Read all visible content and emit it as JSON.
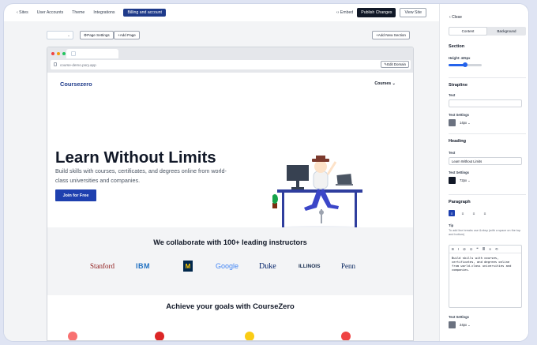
{
  "topbar": {
    "back": "Sites",
    "nav": [
      "User Accounts",
      "Theme",
      "Integrations",
      "Billing and account"
    ],
    "embed": "Embed",
    "publish": "Publish Changes",
    "view": "View Site"
  },
  "toolbar": {
    "page_settings": "Page Settings",
    "add_page": "Add Page",
    "add_section": "Add New Section"
  },
  "browser": {
    "url": "course-demo.pory.app",
    "edit_domain": "Edit Domain"
  },
  "site": {
    "logo": "Coursezero",
    "courses": "Courses",
    "hero_title": "Learn Without Limits",
    "hero_paragraph": "Build skills with courses, certificates, and degrees online from world-class universities and companies.",
    "cta": "Join for Free",
    "partners_title": "We collaborate with 100+ leading instructors",
    "partners": [
      "Stanford",
      "IBM",
      "M",
      "Google",
      "Duke",
      "ILLINOIS",
      "Penn"
    ],
    "goals_title": "Achieve your goals with CourseZero"
  },
  "panel": {
    "close": "Close",
    "tab_content": "Content",
    "tab_background": "Background",
    "section_heading": "Section",
    "height_label": "Height: 425px",
    "height_fraction": 0.5,
    "strapline_heading": "Strapline",
    "strapline_text_label": "Text",
    "strapline_text_value": "",
    "strapline_settings_label": "Text Settings",
    "strapline_size": "14px",
    "heading_heading": "Heading",
    "heading_text_label": "Text",
    "heading_text_value": "Learn Without Limits",
    "heading_settings_label": "Text Settings",
    "heading_size": "72px",
    "paragraph_heading": "Paragraph",
    "tip_label": "Tip",
    "tip_text": "To add line breaks use &nbsp (with a space on the top and bottom)",
    "paragraph_text": "Build skills with courses,\ncertificates, and degrees online\nfrom world-class universities and\ncompanies.",
    "paragraph_settings_label": "Text Settings",
    "paragraph_size": "24px"
  },
  "colors": {
    "accent": "#1e3a8a",
    "cta": "#1e40af"
  }
}
